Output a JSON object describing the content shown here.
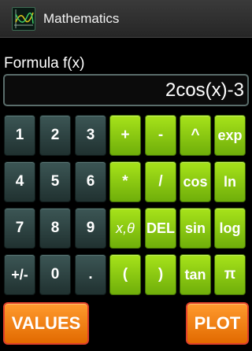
{
  "app": {
    "title": "Mathematics",
    "icon": "function-graph-icon"
  },
  "formula": {
    "label": "Formula f(x)",
    "value": "2cos(x)-3"
  },
  "keypad": {
    "rows": [
      [
        "1",
        "2",
        "3",
        "+",
        "-",
        "^",
        "exp"
      ],
      [
        "4",
        "5",
        "6",
        "*",
        "/",
        "cos",
        "ln"
      ],
      [
        "7",
        "8",
        "9",
        "x,θ",
        "DEL",
        "sin",
        "log"
      ],
      [
        "+/-",
        "0",
        ".",
        "(",
        ")",
        "tan",
        "π"
      ]
    ]
  },
  "actions": {
    "values_label": "VALUES",
    "plot_label": "PLOT"
  },
  "colors": {
    "number_key": "#2e4544",
    "function_key": "#8fcc12",
    "action_button": "#f7851a",
    "action_border": "#e0402a"
  }
}
